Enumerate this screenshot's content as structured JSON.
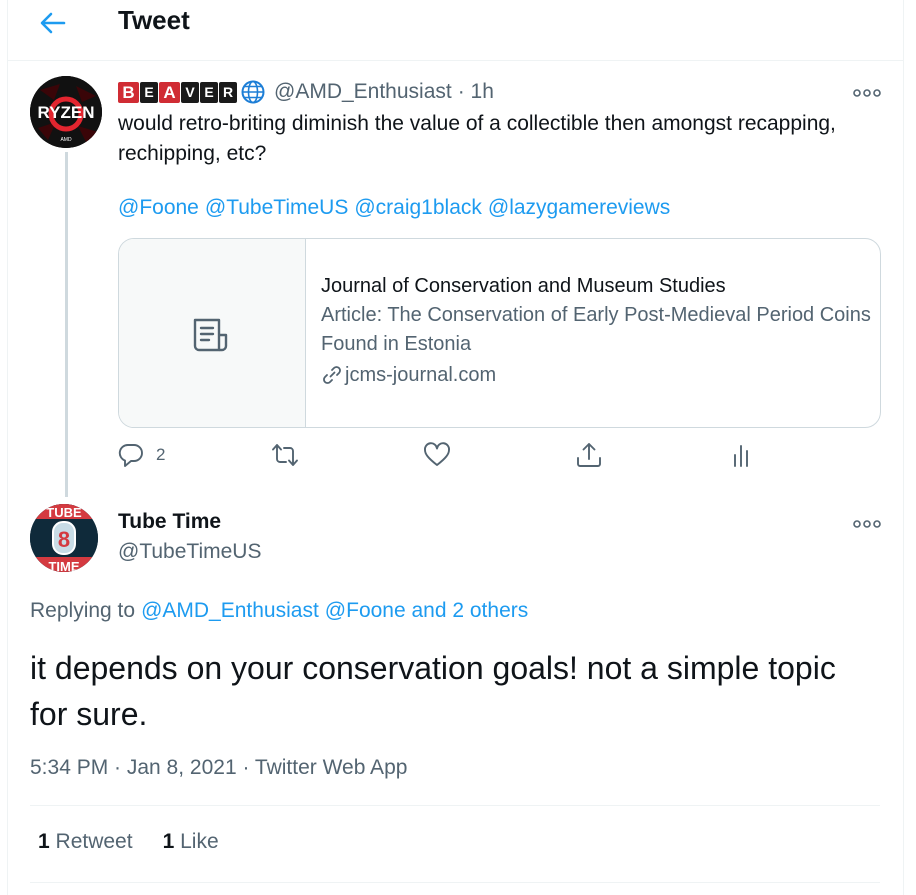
{
  "header": {
    "title": "Tweet"
  },
  "parent_tweet": {
    "badge_letters": [
      "B",
      "E",
      "A",
      "V",
      "E",
      "R"
    ],
    "handle": "@AMD_Enthusiast",
    "time": "· 1h",
    "text": "would retro-briting diminish the value of a collectible then amongst recapping, rechipping, etc?",
    "mentions": [
      "@Foone",
      "@TubeTimeUS",
      "@craig1black",
      "@lazygamereviews"
    ],
    "card": {
      "source": "Journal of Conservation and Museum Studies",
      "title": "Article: The Conservation of Early Post-Medieval Period Coins Found in Estonia",
      "domain": "jcms-journal.com"
    },
    "actions": {
      "reply_count": "2",
      "retweet_count": "",
      "like_count": ""
    }
  },
  "avatar_text": {
    "ryzen": "RYZEN",
    "ryzen_small": "AMD",
    "tube_top": "TUBE",
    "tube_bottom": "TIME",
    "tube_digit": "8"
  },
  "main_tweet": {
    "name": "Tube Time",
    "handle": "@TubeTimeUS",
    "replying_prefix": "Replying to",
    "replying_handle": "@AMD_Enthusiast",
    "replying_rest": "@Foone and 2 others",
    "text": "it depends on your conservation goals! not a simple topic for sure.",
    "timestamp": "5:34 PM · Jan 8, 2021 · Twitter Web App",
    "retweet_count": "1",
    "retweet_label": "Retweet",
    "like_count": "1",
    "like_label": "Like"
  },
  "colors": {
    "accent": "#1d9bf0",
    "secondary_text": "#536471",
    "border": "#cfd9de",
    "badge_red": "#d02c34"
  }
}
